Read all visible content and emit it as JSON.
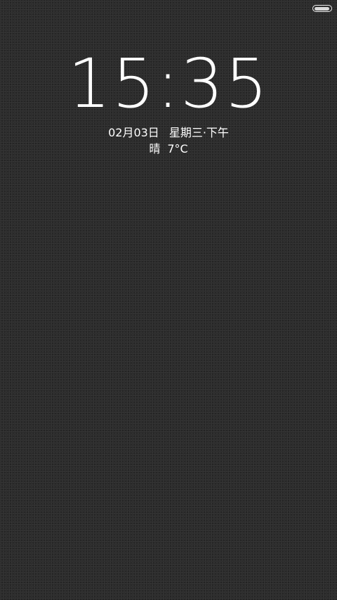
{
  "status_bar": {
    "battery_icon": "battery-icon",
    "battery_level": 0.95
  },
  "lockscreen": {
    "time": "15:35",
    "date": "02月03日",
    "weekday": "星期三·下午",
    "weather_condition": "晴",
    "temperature": "7°C"
  }
}
